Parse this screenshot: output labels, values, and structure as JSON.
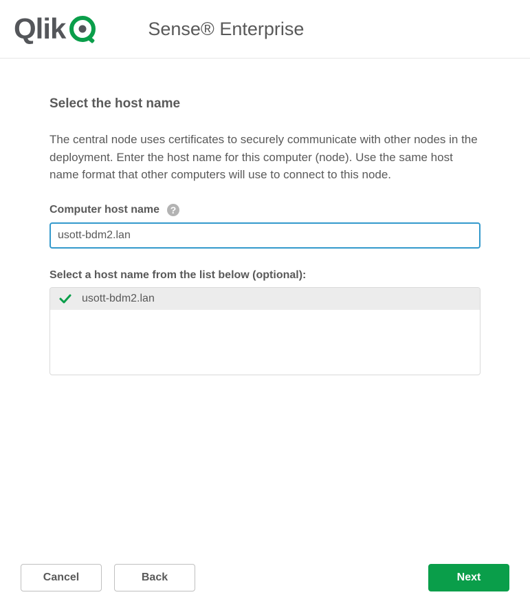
{
  "header": {
    "logo_text": "Qlik",
    "product_title": "Sense® Enterprise"
  },
  "step": {
    "heading": "Select the host name",
    "description": "The central node uses certificates to securely communicate with other nodes in the deployment. Enter the host name for this computer (node). Use the same host name format that other computers will use to connect to this node.",
    "hostname_label": "Computer host name",
    "hostname_value": "usott-bdm2.lan",
    "list_label": "Select a host name from the list below (optional):",
    "host_options": [
      {
        "name": "usott-bdm2.lan",
        "selected": true
      }
    ]
  },
  "buttons": {
    "cancel": "Cancel",
    "back": "Back",
    "next": "Next"
  }
}
